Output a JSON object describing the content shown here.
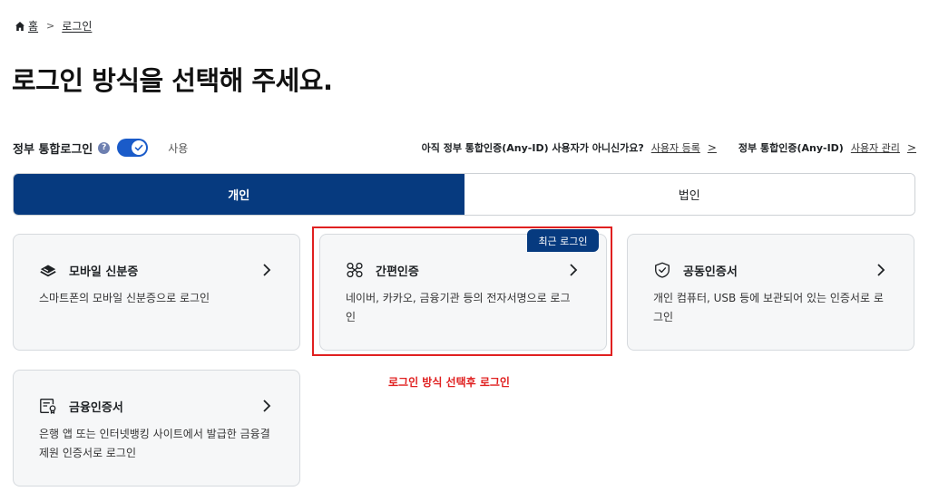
{
  "breadcrumb": {
    "home": "홈",
    "separator": ">",
    "current": "로그인"
  },
  "page_title": "로그인 방식을 선택해 주세요.",
  "gov_login": {
    "label": "정부 통합로그인",
    "help": "?",
    "toggle_on": true,
    "toggle_label": "사용"
  },
  "right_links": {
    "question": "아직 정부 통합인증(Any-ID) 사용자가 아니신가요?",
    "register": "사용자 등록",
    "manage_prefix": "정부 통합인증(Any-ID)",
    "manage": "사용자 관리",
    "chevron": ">"
  },
  "tabs": [
    {
      "label": "개인",
      "active": true
    },
    {
      "label": "법인",
      "active": false
    }
  ],
  "cards": [
    {
      "title": "모바일 신분증",
      "desc": "스마트폰의 모바일 신분증으로 로그인",
      "icon": "mobile-id-icon"
    },
    {
      "title": "간편인증",
      "desc": "네이버, 카카오, 금융기관 등의 전자서명으로 로그인",
      "icon": "simple-auth-icon"
    },
    {
      "title": "공동인증서",
      "desc": "개인 컴퓨터, USB 등에 보관되어 있는 인증서로 로그인",
      "icon": "shield-check-icon"
    },
    {
      "title": "금융인증서",
      "desc": "은행 앱 또는 인터넷뱅킹 사이트에서 발급한 금융결제원 인증서로 로그인",
      "icon": "finance-cert-icon"
    }
  ],
  "badge": "최근 로그인",
  "annotation": "로그인 방식 선택후 로그인",
  "colors": {
    "primary": "#063a7f",
    "toggle": "#1a5bc9",
    "highlight": "#e02020"
  }
}
